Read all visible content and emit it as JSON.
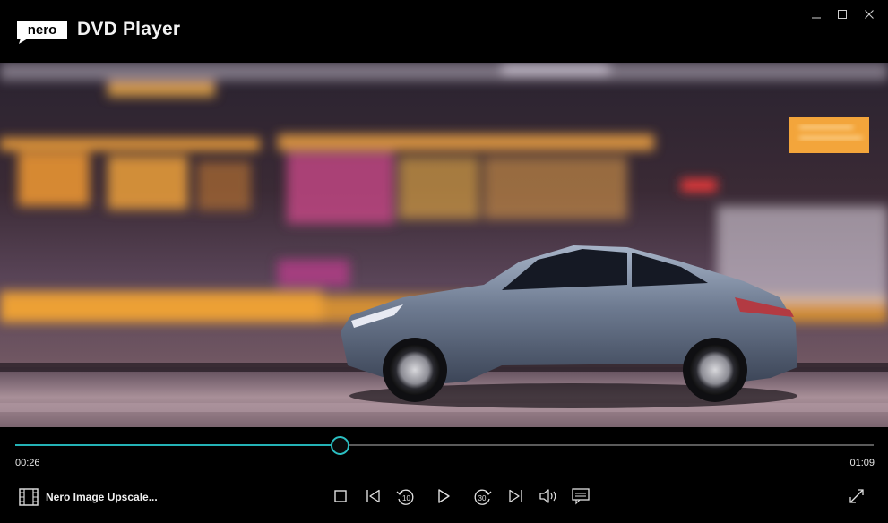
{
  "app": {
    "logo_text": "nero",
    "title": "DVD Player"
  },
  "window_controls": [
    "minimize",
    "maximize",
    "close"
  ],
  "player": {
    "current_time": "00:26",
    "total_time": "01:09",
    "progress": 0.378,
    "media_title": "Nero Image Upscale...",
    "accent_color": "#24b2b5",
    "skip_back_seconds": "10",
    "skip_forward_seconds": "30",
    "controls": [
      "stop",
      "previous",
      "rewind-10",
      "play",
      "forward-30",
      "next",
      "volume",
      "subtitles"
    ]
  }
}
